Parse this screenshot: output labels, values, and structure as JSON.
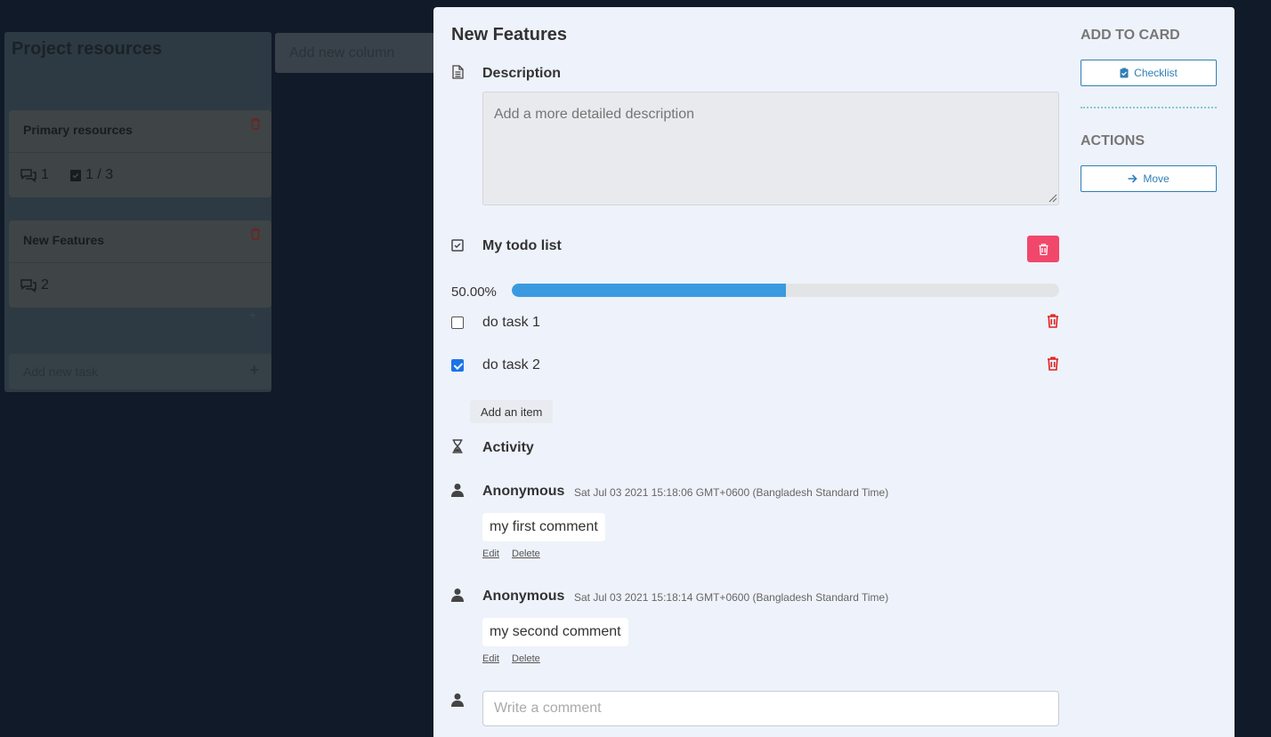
{
  "board": {
    "column_title": "Project resources",
    "cards": [
      {
        "name": "Primary resources",
        "comments": "1",
        "checklist": "1 / 3"
      },
      {
        "name": "New Features",
        "comments": "2"
      }
    ],
    "add_task_placeholder": "Add new task",
    "add_column_placeholder": "Add new column"
  },
  "modal": {
    "title": "New Features",
    "description": {
      "heading": "Description",
      "placeholder": "Add a more detailed description"
    },
    "checklist": {
      "title": "My todo list",
      "progress_text": "50.00%",
      "progress_fraction": 0.5,
      "items": [
        {
          "label": "do task 1",
          "checked": false
        },
        {
          "label": "do task 2",
          "checked": true
        }
      ],
      "add_item_label": "Add an item"
    },
    "activity": {
      "heading": "Activity",
      "comments": [
        {
          "author": "Anonymous",
          "time": "Sat Jul 03 2021 15:18:06 GMT+0600 (Bangladesh Standard Time)",
          "text": "my first comment",
          "edit_label": "Edit",
          "delete_label": "Delete"
        },
        {
          "author": "Anonymous",
          "time": "Sat Jul 03 2021 15:18:14 GMT+0600 (Bangladesh Standard Time)",
          "text": "my second comment",
          "edit_label": "Edit",
          "delete_label": "Delete"
        }
      ],
      "comment_placeholder": "Write a comment"
    },
    "sidebar": {
      "add_to_card_heading": "ADD TO CARD",
      "checklist_button": "Checklist",
      "actions_heading": "ACTIONS",
      "move_button": "Move"
    }
  },
  "colors": {
    "accent": "#3a9ae0",
    "danger": "#f1476b",
    "checkbox": "#1a73e8",
    "button_border": "#2f7fb5"
  }
}
